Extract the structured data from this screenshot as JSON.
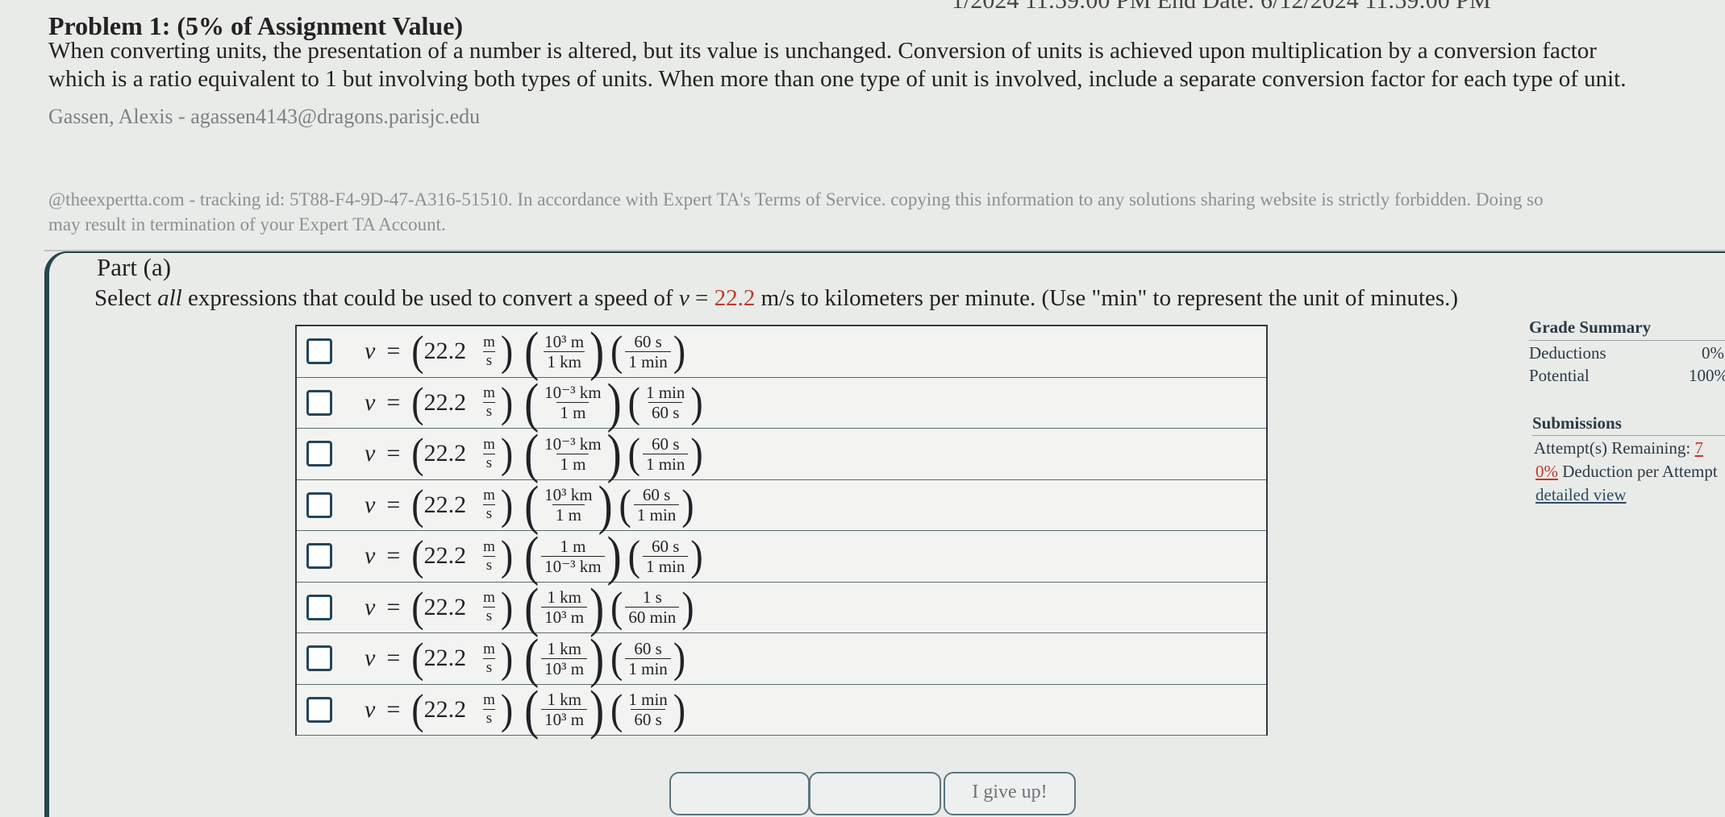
{
  "header": {
    "end_date": "1/2024 11:59:00 PM End Date: 6/12/2024 11:59:00 PM"
  },
  "problem": {
    "title": "Problem 1: (5% of Assignment Value)",
    "text_lines": [
      "When converting units, the presentation of a number is altered, but its value is unchanged. Conversion of units is achieved upon multiplication by a conversion factor",
      "which is a ratio equivalent to 1 but involving both types of units. When more than one type of unit is involved, include a separate conversion factor for each type of unit."
    ],
    "student": "Gassen, Alexis - agassen4143@dragons.parisjc.edu",
    "tracking_lines": [
      "@theexpertta.com - tracking id: 5T88-F4-9D-47-A316-51510. In accordance with Expert TA's Terms of Service. copying this information to any solutions sharing website is strictly forbidden. Doing so",
      "may result in termination of your Expert TA Account."
    ]
  },
  "part": {
    "title": "Part (a)",
    "question_prefix": "Select ",
    "question_emph": "all",
    "question_mid": " expressions that could be used to convert a speed of ",
    "question_var": "v",
    "question_eq": " = ",
    "question_value": "22.2",
    "question_unit": " m/s",
    "question_suffix": " to kilometers per minute. (Use \"min\" to represent the unit of minutes.)"
  },
  "expression_common": {
    "var": "v",
    "eq": "=",
    "value": "22.2",
    "unit_num": "m",
    "unit_den": "s"
  },
  "options": [
    {
      "f1_num": "10³ m",
      "f1_den": "1 km",
      "f2_num": "60 s",
      "f2_den": "1 min"
    },
    {
      "f1_num": "10⁻³ km",
      "f1_den": "1 m",
      "f2_num": "1 min",
      "f2_den": "60 s"
    },
    {
      "f1_num": "10⁻³ km",
      "f1_den": "1 m",
      "f2_num": "60 s",
      "f2_den": "1 min"
    },
    {
      "f1_num": "10³ km",
      "f1_den": "1 m",
      "f2_num": "60 s",
      "f2_den": "1 min"
    },
    {
      "f1_num": "1 m",
      "f1_den": "10⁻³ km",
      "f2_num": "60 s",
      "f2_den": "1 min"
    },
    {
      "f1_num": "1 km",
      "f1_den": "10³ m",
      "f2_num": "1 s",
      "f2_den": "60 min"
    },
    {
      "f1_num": "1 km",
      "f1_den": "10³ m",
      "f2_num": "60 s",
      "f2_den": "1 min"
    },
    {
      "f1_num": "1 km",
      "f1_den": "10³ m",
      "f2_num": "1 min",
      "f2_den": "60 s"
    }
  ],
  "grade_summary": {
    "title": "Grade Summary",
    "deductions_label": "Deductions",
    "deductions_value": "0%",
    "potential_label": "Potential",
    "potential_value": "100%"
  },
  "submissions": {
    "title": "Submissions",
    "attempts_label": "Attempt(s) Remaining: ",
    "attempts_value": "7",
    "deduction_value": "0%",
    "deduction_label": " Deduction per Attempt",
    "detailed_view": "detailed view"
  },
  "bottom": {
    "give_up": "I give up!"
  }
}
